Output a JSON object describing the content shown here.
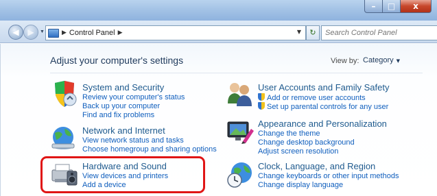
{
  "window": {
    "minimize_glyph": "–",
    "maximize_glyph": "□",
    "close_glyph": "x"
  },
  "address_bar": {
    "breadcrumb": [
      "Control Panel"
    ],
    "search_placeholder": "Search Control Panel"
  },
  "header": {
    "title": "Adjust your computer's settings",
    "view_by_label": "View by:",
    "view_by_value": "Category"
  },
  "categories": [
    {
      "icon": "security-shield-icon",
      "title": "System and Security",
      "links": [
        "Review your computer's status",
        "Back up your computer",
        "Find and fix problems"
      ]
    },
    {
      "icon": "network-globe-icon",
      "title": "Network and Internet",
      "links": [
        "View network status and tasks",
        "Choose homegroup and sharing options"
      ]
    },
    {
      "icon": "printer-speaker-icon",
      "title": "Hardware and Sound",
      "links": [
        "View devices and printers",
        "Add a device"
      ]
    },
    {
      "icon": "users-icon",
      "title": "User Accounts and Family Safety",
      "links": [
        "Add or remove user accounts",
        "Set up parental controls for any user"
      ]
    },
    {
      "icon": "display-palette-icon",
      "title": "Appearance and Personalization",
      "links": [
        "Change the theme",
        "Change desktop background",
        "Adjust screen resolution"
      ]
    },
    {
      "icon": "clock-globe-icon",
      "title": "Clock, Language, and Region",
      "links": [
        "Change keyboards or other input methods",
        "Change display language"
      ]
    }
  ],
  "annotation": {
    "highlighted_category": "Hardware and Sound",
    "color": "#e01515"
  },
  "colors": {
    "title_link": "#1e5a8e",
    "task_link": "#0f5ebd",
    "heading": "#1e395b"
  }
}
